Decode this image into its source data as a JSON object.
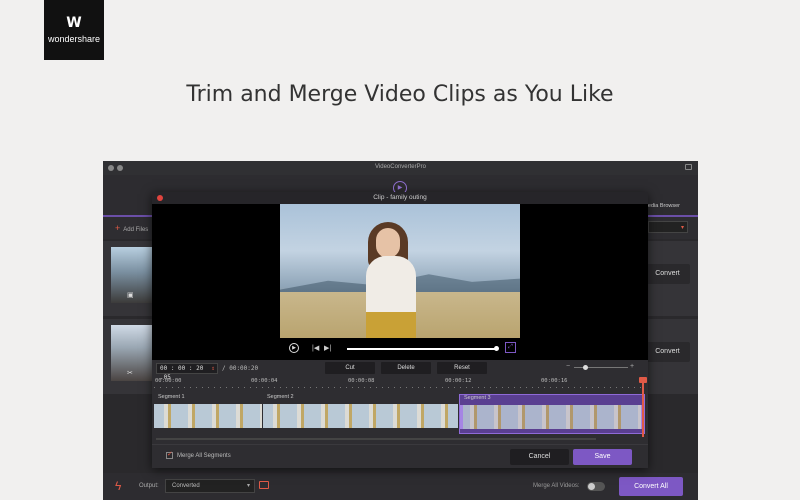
{
  "brand": {
    "mark": "W",
    "name": "wondershare"
  },
  "headline": "Trim and Merge Video Clips as You Like",
  "app": {
    "title": "VideoConverterPro",
    "add_files": "Add Files",
    "media_browser": "Media Browser",
    "rows": [
      {
        "convert_label": "Convert"
      },
      {
        "convert_label": "Convert"
      }
    ],
    "bottom": {
      "output_label": "Output:",
      "output_value": "Converted",
      "merge_all_videos": "Merge All Videos:",
      "merge_all_videos_on": false,
      "convert_all": "Convert All"
    }
  },
  "dialog": {
    "title": "Clip - family outing",
    "playback_progress": 0.99,
    "time_value": "00 : 00 : 20 .05",
    "duration": "/ 00:00:20",
    "buttons": {
      "cut": "Cut",
      "delete": "Delete",
      "reset": "Reset"
    },
    "zoom_level": 0.2,
    "ruler_ticks": [
      "00:00:00",
      "00:00:04",
      "00:00:08",
      "00:00:12",
      "00:00:16"
    ],
    "segments": [
      {
        "label": "Segment 1",
        "selected": false
      },
      {
        "label": "Segment 2",
        "selected": false
      },
      {
        "label": "Segment 3",
        "selected": true
      }
    ],
    "merge_segments_label": "Merge All Segments",
    "merge_segments_checked": true,
    "cancel": "Cancel",
    "save": "Save"
  },
  "colors": {
    "accent": "#7d58c4",
    "highlight": "#e05a47"
  }
}
